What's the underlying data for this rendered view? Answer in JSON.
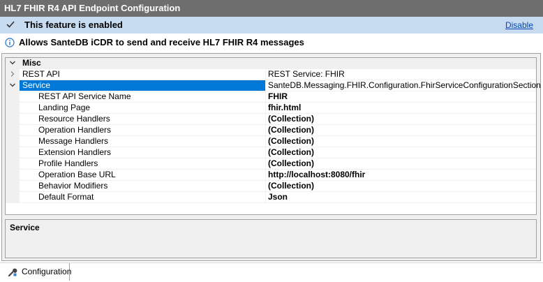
{
  "window": {
    "title": "HL7 FHIR R4 API Endpoint Configuration"
  },
  "status": {
    "text": "This feature is enabled",
    "disable_label": "Disable",
    "icon": "checkmark-icon"
  },
  "info": {
    "text": "Allows SanteDB iCDR to send and receive HL7 FHIR R4 messages",
    "icon": "info-icon"
  },
  "grid": {
    "category": "Misc",
    "rest_api": {
      "label": "REST API",
      "value": "REST Service: FHIR"
    },
    "service": {
      "label": "Service",
      "value": "SanteDB.Messaging.FHIR.Configuration.FhirServiceConfigurationSection"
    },
    "props": [
      {
        "label": "REST API Service Name",
        "value": "FHIR"
      },
      {
        "label": "Landing Page",
        "value": "fhir.html"
      },
      {
        "label": "Resource Handlers",
        "value": "(Collection)"
      },
      {
        "label": "Operation Handlers",
        "value": "(Collection)"
      },
      {
        "label": "Message Handlers",
        "value": "(Collection)"
      },
      {
        "label": "Extension Handlers",
        "value": "(Collection)"
      },
      {
        "label": "Profile Handlers",
        "value": "(Collection)"
      },
      {
        "label": "Operation Base URL",
        "value": "http://localhost:8080/fhir"
      },
      {
        "label": "Behavior Modifiers",
        "value": "(Collection)"
      },
      {
        "label": "Default Format",
        "value": "Json"
      }
    ]
  },
  "description": {
    "title": "Service"
  },
  "tabs": [
    {
      "label": "Configuration",
      "icon": "wrench-icon"
    }
  ],
  "colors": {
    "title_bg": "#6e6e6e",
    "status_bg": "#c7dbf1",
    "selection": "#0078d7",
    "link": "#0645ad"
  }
}
